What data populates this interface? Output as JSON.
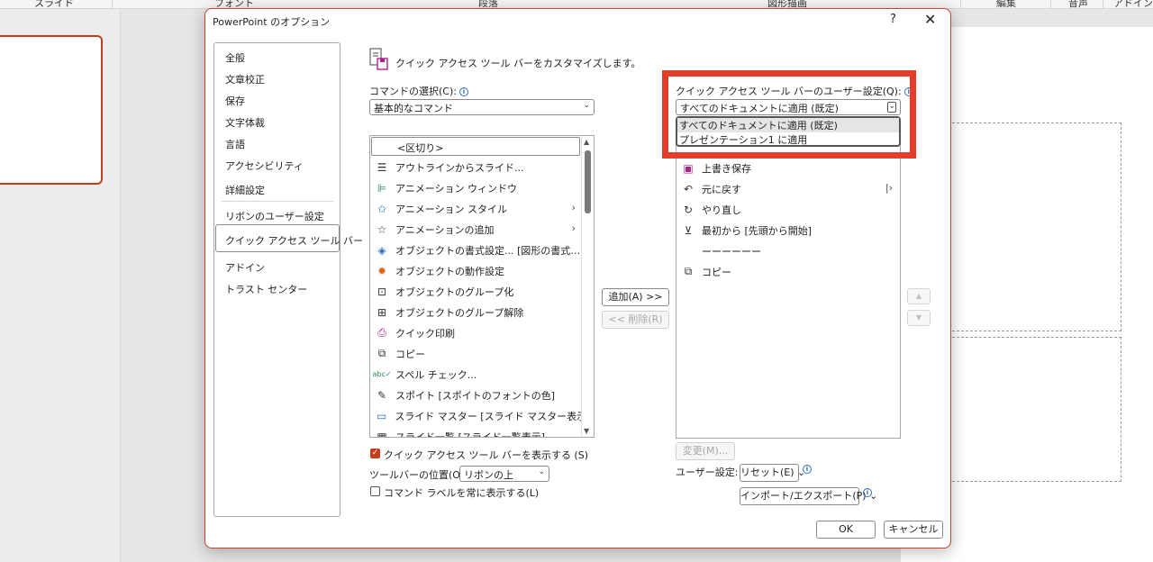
{
  "ribbon": {
    "slide": "スライド",
    "font": "フォント",
    "paragraph": "段落",
    "drawing": "図形描画",
    "editing": "編集",
    "voice": "音声",
    "addins": "アドイン"
  },
  "dialog": {
    "title": "PowerPoint のオプション",
    "help": "?",
    "close": "✕"
  },
  "nav": {
    "items": [
      "全般",
      "文章校正",
      "保存",
      "文字体裁",
      "言語",
      "アクセシビリティ",
      "詳細設定",
      "リボンのユーザー設定",
      "クイック アクセス ツール バー",
      "アドイン",
      "トラスト センター"
    ],
    "selected": "クイック アクセス ツール バー"
  },
  "qat": {
    "heading": "クイック アクセス ツール バーをカスタマイズします。"
  },
  "commands": {
    "label": "コマンドの選択(C):",
    "selected": "基本的なコマンド",
    "items": [
      {
        "label": "<区切り>",
        "icon": "separator"
      },
      {
        "label": "アウトラインからスライド...",
        "icon": "outline-icon"
      },
      {
        "label": "アニメーション ウィンドウ",
        "icon": "animation-pane-icon"
      },
      {
        "label": "アニメーション スタイル",
        "icon": "star-icon",
        "submenu": true
      },
      {
        "label": "アニメーションの追加",
        "icon": "star-add-icon",
        "submenu": true
      },
      {
        "label": "オブジェクトの書式設定... [図形の書式…",
        "icon": "format-icon"
      },
      {
        "label": "オブジェクトの動作設定",
        "icon": "action-icon"
      },
      {
        "label": "オブジェクトのグループ化",
        "icon": "group-icon"
      },
      {
        "label": "オブジェクトのグループ解除",
        "icon": "ungroup-icon"
      },
      {
        "label": "クイック印刷",
        "icon": "print-icon"
      },
      {
        "label": "コピー",
        "icon": "copy-icon"
      },
      {
        "label": "スペル チェック...",
        "icon": "spellcheck-icon"
      },
      {
        "label": "スポイト [スポイトのフォントの色]",
        "icon": "eyedropper-icon"
      },
      {
        "label": "スライド マスター [スライド マスター表示]",
        "icon": "slide-master-icon"
      },
      {
        "label": "スライド一覧 [スライド一覧表示]",
        "icon": "slide-sorter-icon"
      }
    ]
  },
  "add_button": "追加(A) >>",
  "remove_button": "<< 削除(R)",
  "show_toolbar": {
    "label": "クイック アクセス ツール バーを表示する (S)",
    "checked": true
  },
  "position": {
    "label": "ツールバーの位置(O)",
    "value": "リボンの上"
  },
  "always_label": {
    "label": "コマンド ラベルを常に表示する(L)",
    "checked": false
  },
  "customize": {
    "label": "クイック アクセス ツール バーのユーザー設定(Q):",
    "selected": "すべてのドキュメントに適用 (既定)",
    "options": [
      "すべてのドキュメントに適用 (既定)",
      "プレゼンテーション1 に適用"
    ]
  },
  "qat_items": [
    {
      "label": "上書き保存",
      "icon": "save-icon"
    },
    {
      "label": "元に戻す",
      "icon": "undo-icon",
      "submenu": true
    },
    {
      "label": "やり直し",
      "icon": "redo-icon"
    },
    {
      "label": "最初から [先頭から開始]",
      "icon": "slideshow-icon"
    },
    {
      "label": "ーーーーーー",
      "icon": "separator"
    },
    {
      "label": "コピー",
      "icon": "copy-icon"
    }
  ],
  "modify_button": "変更(M)...",
  "user_settings": {
    "label": "ユーザー設定:",
    "reset": "リセット(E)",
    "import_export": "インポート/エクスポート(P)"
  },
  "ok": "OK",
  "cancel": "キャンセル",
  "colors": {
    "accent": "#c43e1c",
    "highlight": "#e23e2b"
  }
}
